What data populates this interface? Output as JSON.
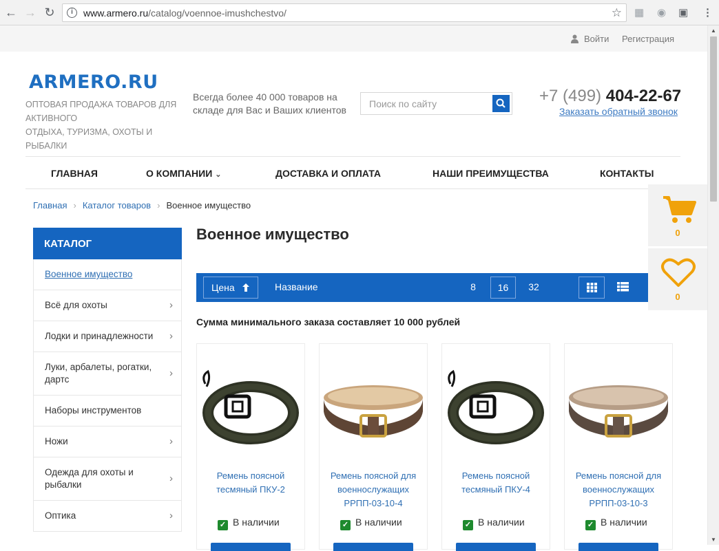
{
  "browser": {
    "url_host": "www.armero.ru",
    "url_path": "/catalog/voennoe-imushchestvo/"
  },
  "topbar": {
    "login": "Войти",
    "register": "Регистрация"
  },
  "header": {
    "logo": "ARMERO.RU",
    "tagline_1": "Оптовая продажа товаров для активного",
    "tagline_2": "отдыха, туризма, охоты и рыбалки",
    "slogan": "Всегда более 40 000 товаров на складе для Вас и Ваших клиентов",
    "search_placeholder": "Поиск по сайту",
    "phone_prefix": "+7 (499)",
    "phone_number": "404-22-67",
    "callback": "Заказать обратный звонок"
  },
  "nav": {
    "home": "Главная",
    "about": "О компании",
    "delivery": "Доставка и оплата",
    "advantages": "Наши преимущества",
    "contacts": "Контакты"
  },
  "breadcrumb": {
    "home": "Главная",
    "catalog": "Каталог товаров",
    "current": "Военное имущество"
  },
  "catalog": {
    "title": "Каталог",
    "items": [
      "Военное имущество",
      "Всё для охоты",
      "Лодки и принадлежности",
      "Луки, арбалеты, рогатки, дартс",
      "Наборы инструментов",
      "Ножи",
      "Одежда для охоты и рыбалки",
      "Оптика"
    ]
  },
  "page_title": "Военное имущество",
  "sortbar": {
    "price": "Цена",
    "name": "Название",
    "per_page": [
      "8",
      "16",
      "32"
    ],
    "per_page_selected": "16"
  },
  "min_order": "Сумма минимального заказа составляет 10 000 рублей",
  "products": [
    {
      "name": "Ремень поясной тесмяный ПКУ-2",
      "stock": "В наличии"
    },
    {
      "name": "Ремень поясной для военнослужащих РРПП-03-10-4",
      "stock": "В наличии"
    },
    {
      "name": "Ремень поясной тесмяный ПКУ-4",
      "stock": "В наличии"
    },
    {
      "name": "Ремень поясной для военнослужащих РРПП-03-10-3",
      "stock": "В наличии"
    }
  ],
  "widgets": {
    "cart_count": "0",
    "wishlist_count": "0"
  },
  "colors": {
    "brand_blue": "#1565c0",
    "accent_orange": "#f0a20b",
    "stock_green": "#1e8a2e"
  }
}
